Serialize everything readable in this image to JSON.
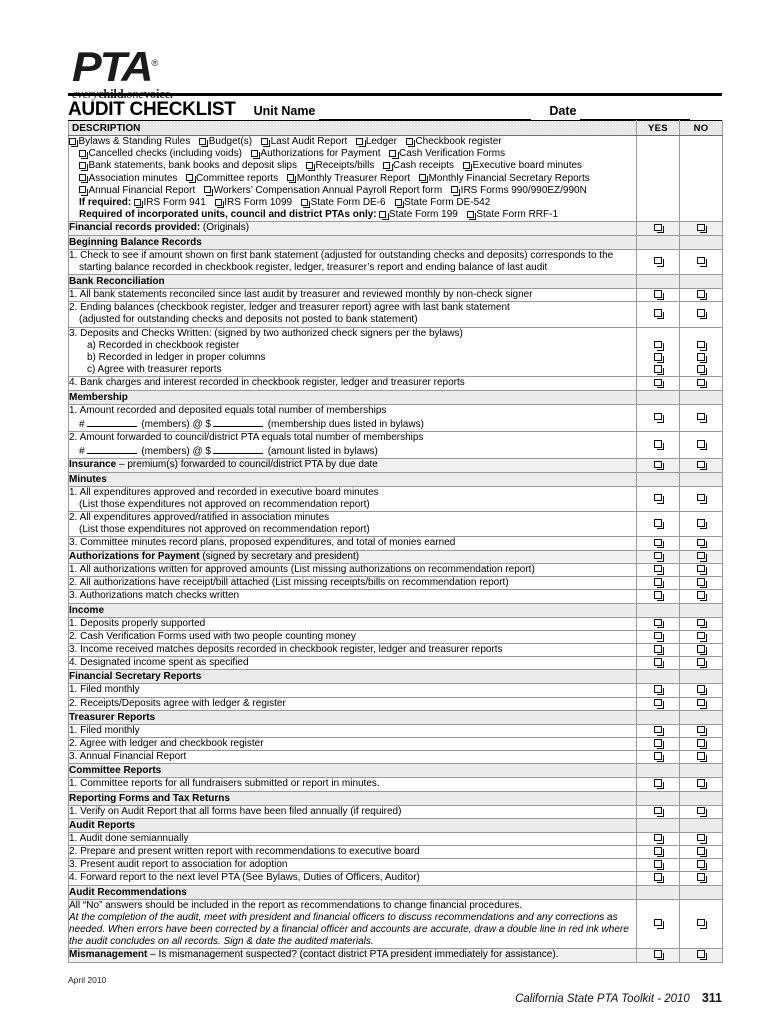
{
  "logo": {
    "mark": "PTA",
    "registered": "®",
    "tagline_every": "every",
    "tagline_child": "child.",
    "tagline_one": "one",
    "tagline_voice": "voice."
  },
  "header": {
    "title": "AUDIT CHECKLIST",
    "unit_name_label": "Unit Name",
    "date_label": "Date",
    "unit_name_value": "",
    "date_value": ""
  },
  "columns": {
    "description": "DESCRIPTION",
    "yes": "YES",
    "no": "NO"
  },
  "records_block": {
    "lines": [
      [
        "Bylaws & Standing Rules",
        "Budget(s)",
        "Last Audit Report",
        "Ledger",
        "Checkbook register"
      ],
      [
        "Cancelled checks (including voids)",
        "Authorizations for Payment",
        "Cash Verification Forms"
      ],
      [
        "Bank statements, bank books and deposit slips",
        "Receipts/bills",
        "Cash receipts",
        "Executive board minutes"
      ],
      [
        "Association minutes",
        "Committee reports",
        "Monthly Treasurer Report",
        "Monthly Financial Secretary Reports"
      ],
      [
        "Annual Financial Report",
        "Workers’ Compensation Annual Payroll Report form",
        "IRS Forms 990/990EZ/990N"
      ]
    ],
    "if_required_label": "If required:",
    "if_required_items": [
      "IRS Form 941",
      "IRS Form 1099",
      "State Form DE-6",
      "State Form DE-542"
    ],
    "incorporated_label": "Required of incorporated units, council and district PTAs only:",
    "incorporated_items": [
      "State Form 199",
      "State Form RRF-1"
    ]
  },
  "rows": [
    {
      "id": "financial-records-provided",
      "kind": "shaded-item",
      "lead": "Financial records provided:",
      "text": " (Originals)",
      "boxes": true
    },
    {
      "id": "beginning-balance-records",
      "kind": "section",
      "label": "Beginning Balance  Records"
    },
    {
      "id": "bb-1",
      "kind": "item",
      "text": "1. Check to see if amount shown on first bank statement (adjusted for outstanding checks and deposits) corresponds to the",
      "text2": "starting balance recorded in checkbook register, ledger, treasurer’s report and ending balance of last audit",
      "boxes": true
    },
    {
      "id": "bank-reconciliation",
      "kind": "section",
      "label": "Bank Reconciliation"
    },
    {
      "id": "br-1",
      "kind": "item",
      "text": "1. All bank statements reconciled since last audit by treasurer and reviewed monthly by non-check signer",
      "boxes": true
    },
    {
      "id": "br-2",
      "kind": "item",
      "text": "2. Ending balances (checkbook register, ledger and treasurer report) agree with last bank statement",
      "text2": "(adjusted for outstanding checks and deposits not posted to bank statement)",
      "boxes": true
    },
    {
      "id": "br-3",
      "kind": "multi",
      "text": "3. Deposits and Checks Written: (signed by two authorized check signers per the bylaws)",
      "subitems": [
        "a)  Recorded in checkbook register",
        "b)  Recorded in ledger in proper columns",
        "c)  Agree with treasurer reports"
      ]
    },
    {
      "id": "br-4",
      "kind": "item",
      "text": "4. Bank charges and interest recorded in checkbook register, ledger and treasurer reports",
      "boxes": true
    },
    {
      "id": "membership",
      "kind": "section",
      "label": "Membership"
    },
    {
      "id": "mem-1",
      "kind": "fill",
      "text": "1. Amount recorded and deposited equals total number of memberships",
      "fill_prefix": "#",
      "fill_mid": "(members) @ $",
      "fill_suffix": "(membership dues listed in bylaws)",
      "boxes": true
    },
    {
      "id": "mem-2",
      "kind": "fill",
      "text": "2. Amount forwarded to council/district PTA equals total number of memberships",
      "fill_prefix": "#",
      "fill_mid": "(members) @ $",
      "fill_suffix": "(amount listed in bylaws)",
      "boxes": true
    },
    {
      "id": "insurance",
      "kind": "shaded-item",
      "lead": "Insurance",
      "text": " – premium(s) forwarded to council/district PTA by due date",
      "boxes": true
    },
    {
      "id": "minutes",
      "kind": "section",
      "label": "Minutes"
    },
    {
      "id": "min-1",
      "kind": "item",
      "text": "1. All expenditures approved and recorded in executive board minutes",
      "text2": "(List those expenditures not approved on recommendation report)",
      "boxes": true
    },
    {
      "id": "min-2",
      "kind": "item",
      "text": "2. All expenditures approved/ratified in association minutes",
      "text2": "(List those expenditures not approved on recommendation report)",
      "boxes": true
    },
    {
      "id": "min-3",
      "kind": "item",
      "text": "3. Committee minutes record plans, proposed expenditures, and total of monies earned",
      "boxes": true
    },
    {
      "id": "authorizations-for-payment",
      "kind": "shaded-item",
      "lead": "Authorizations for Payment",
      "text": " (signed by secretary and president)",
      "boxes": true
    },
    {
      "id": "auth-1",
      "kind": "item",
      "text": "1. All authorizations written for approved amounts (List missing authorizations on recommendation report)",
      "boxes": true
    },
    {
      "id": "auth-2",
      "kind": "item",
      "text": "2. All authorizations have receipt/bill attached (List missing receipts/bills on recommendation report)",
      "boxes": true
    },
    {
      "id": "auth-3",
      "kind": "item",
      "text": "3. Authorizations match checks written",
      "boxes": true
    },
    {
      "id": "income",
      "kind": "section",
      "label": "Income"
    },
    {
      "id": "inc-1",
      "kind": "item",
      "text": "1. Deposits properly supported",
      "boxes": true
    },
    {
      "id": "inc-2",
      "kind": "item",
      "text": "2. Cash Verification Forms used with two people counting money",
      "boxes": true
    },
    {
      "id": "inc-3",
      "kind": "item",
      "text": "3. Income received matches deposits recorded in checkbook register, ledger and treasurer reports",
      "boxes": true
    },
    {
      "id": "inc-4",
      "kind": "item",
      "text": "4. Designated income spent as specified",
      "boxes": true
    },
    {
      "id": "financial-secretary-reports",
      "kind": "section",
      "label": "Financial Secretary Reports"
    },
    {
      "id": "fsr-1",
      "kind": "item",
      "text": "1. Filed monthly",
      "boxes": true
    },
    {
      "id": "fsr-2",
      "kind": "item",
      "text": "2. Receipts/Deposits agree with ledger & register",
      "boxes": true
    },
    {
      "id": "treasurer-reports",
      "kind": "section",
      "label": "Treasurer Reports"
    },
    {
      "id": "tr-1",
      "kind": "item",
      "text": "1. Filed monthly",
      "boxes": true
    },
    {
      "id": "tr-2",
      "kind": "item",
      "text": "2. Agree with ledger and checkbook register",
      "boxes": true
    },
    {
      "id": "tr-3",
      "kind": "item",
      "text": "3. Annual Financial Report",
      "boxes": true
    },
    {
      "id": "committee-reports",
      "kind": "section",
      "label": "Committee Reports"
    },
    {
      "id": "cr-1",
      "kind": "item",
      "text": "1. Committee reports for all fundraisers submitted or report in minutes.",
      "boxes": true
    },
    {
      "id": "reporting-forms-and-tax-returns",
      "kind": "section",
      "label": "Reporting Forms and Tax Returns"
    },
    {
      "id": "rf-1",
      "kind": "item",
      "text": "1. Verify on Audit Report that all forms have been filed annually (if required)",
      "boxes": true
    },
    {
      "id": "audit-reports",
      "kind": "section",
      "label": "Audit Reports"
    },
    {
      "id": "ar-1",
      "kind": "item",
      "text": "1. Audit done semiannually",
      "boxes": true
    },
    {
      "id": "ar-2",
      "kind": "item",
      "text": "2. Prepare and present written report with recommendations to executive board",
      "boxes": true
    },
    {
      "id": "ar-3",
      "kind": "item",
      "text": "3. Present audit report to association for adoption",
      "boxes": true
    },
    {
      "id": "ar-4",
      "kind": "item",
      "text": "4. Forward report to the next level PTA (See Bylaws, Duties of Officers, Auditor)",
      "boxes": true
    },
    {
      "id": "audit-recommendations",
      "kind": "section",
      "label": "Audit Recommendations"
    },
    {
      "id": "rec-paragraph",
      "kind": "paragraph",
      "plain": "All “No” answers should be included in the report as recommendations to change financial procedures.",
      "italic": "At the completion of the audit, meet with president and financial officers to discuss recommendations and any corrections as needed. When errors have been corrected by a financial officer and accounts are accurate, draw a double line in red ink where the audit concludes on all records. Sign & date the audited materials.",
      "boxes": true
    },
    {
      "id": "mismanagement",
      "kind": "shaded-item",
      "lead": "Mismanagement",
      "text": " – Is mismanagement suspected? (contact district PTA president immediately for assistance).",
      "boxes": true
    }
  ],
  "footer": {
    "date": "April 2010",
    "source": "California State PTA Toolkit - 2010",
    "page_number": "311"
  }
}
